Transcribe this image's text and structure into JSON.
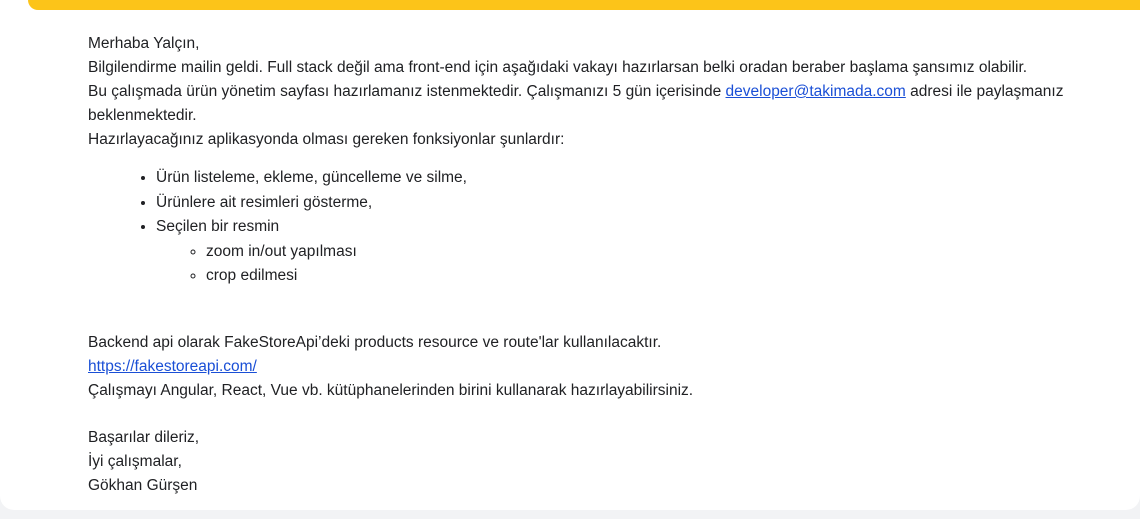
{
  "email": {
    "greeting": "Merhaba Yalçın,",
    "intro": "Bilgilendirme mailin geldi. Full stack değil ama front-end için aşağıdaki vakayı hazırlarsan belki oradan beraber başlama şansımız olabilir.",
    "task_prefix": "Bu çalışmada ürün yönetim sayfası hazırlamanız istenmektedir. Çalışmanızı 5 gün içerisinde ",
    "task_email_link": "developer@takimada.com",
    "task_suffix": " adresi ile paylaşmanız beklenmektedir.",
    "functions_intro": "Hazırlayacağınız aplikasyonda olması gereken fonksiyonlar şunlardır:",
    "features": [
      "Ürün listeleme, ekleme, güncelleme ve silme,",
      "Ürünlere ait resimleri gösterme,",
      "Seçilen bir resmin"
    ],
    "sub_features": [
      "zoom in/out yapılması",
      "crop edilmesi"
    ],
    "backend_text": "Backend api olarak FakeStoreApi’deki products resource ve route'lar kullanılacaktır.",
    "api_link": "https://fakestoreapi.com/",
    "framework_text": "Çalışmayı Angular, React, Vue vb. kütüphanelerinden birini kullanarak hazırlayabilirsiniz.",
    "closing": "Başarılar dileriz,",
    "wishes": "İyi çalışmalar,",
    "signature": "Gökhan Gürşen"
  },
  "colors": {
    "accent_bar": "#fcc419",
    "link": "#1a4fd6",
    "text": "#202124",
    "background": "#ffffff"
  }
}
